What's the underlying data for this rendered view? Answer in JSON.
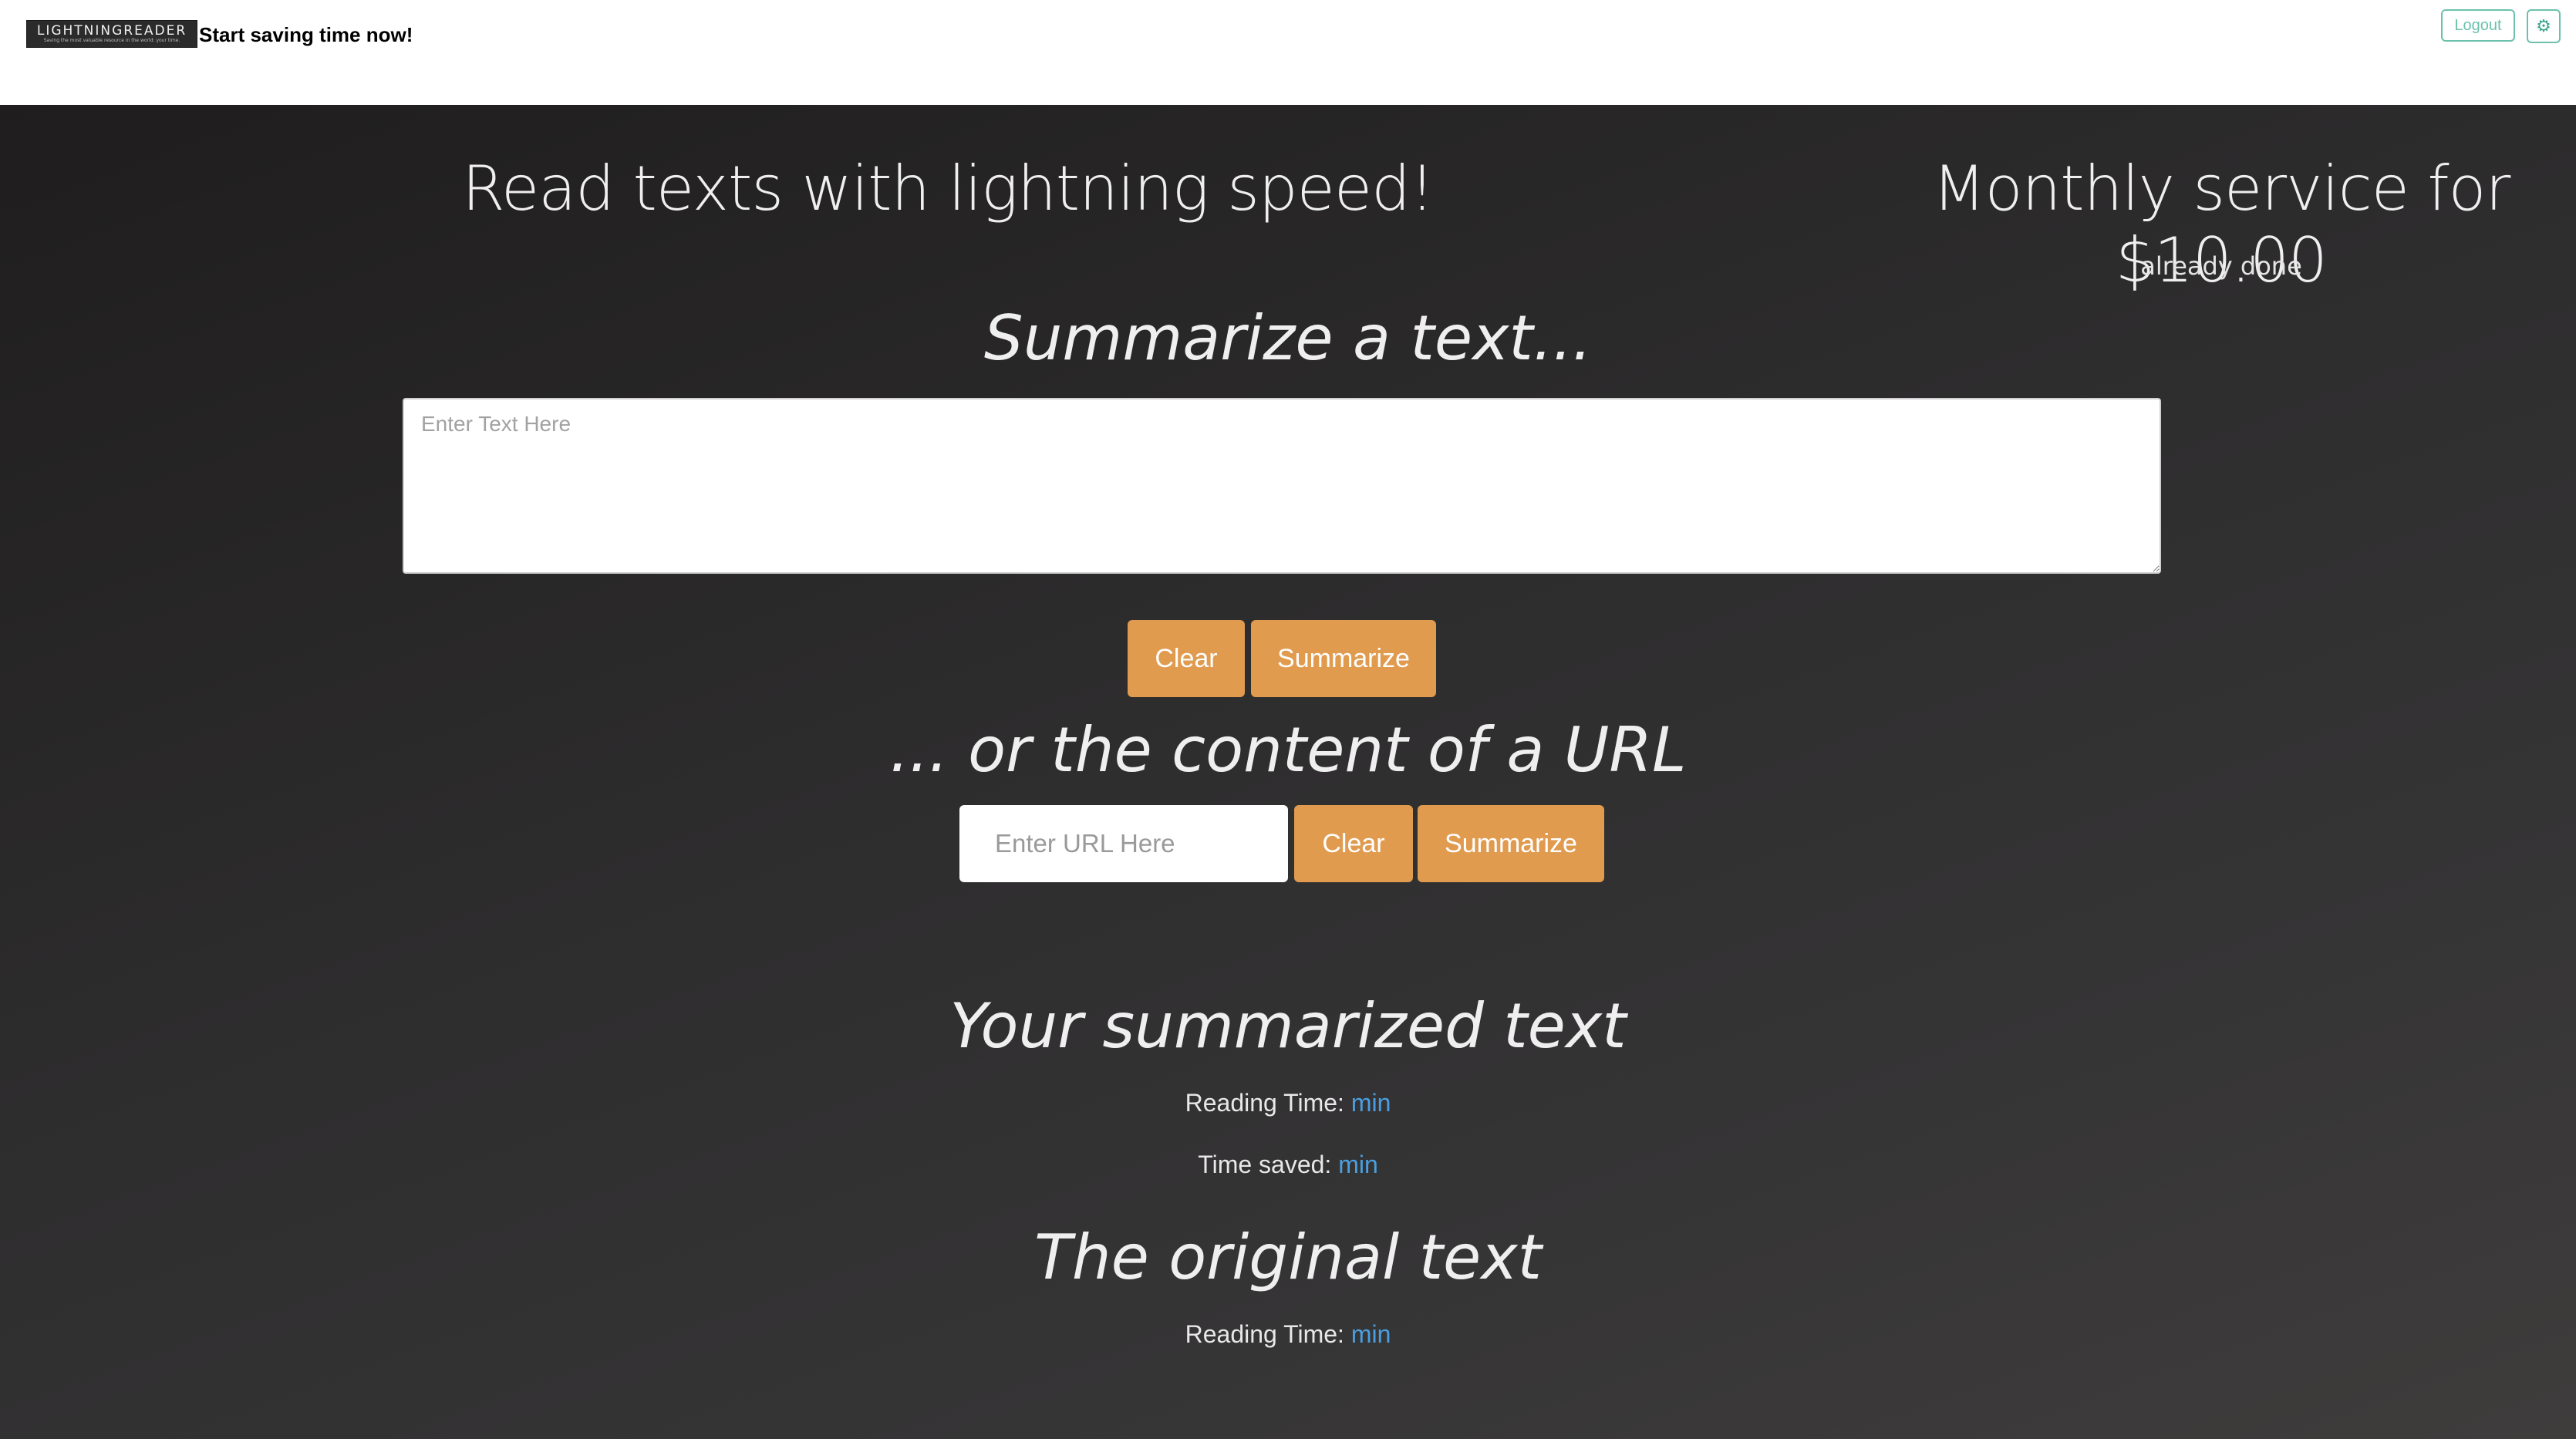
{
  "header": {
    "logo": {
      "word": "LIGHTNINGREADER",
      "tagline": "Saving the most valuable resource in the world: your time."
    },
    "tagline": "Start saving time now!",
    "logout_label": "Logout",
    "settings_icon": "gear-icon"
  },
  "hero": {
    "headline": "Read texts with lightning speed!",
    "price_headline": "Monthly service for $10.00",
    "subscription_status": "already done"
  },
  "text_section": {
    "title": "Summarize a text...",
    "placeholder": "Enter Text Here",
    "clear_label": "Clear",
    "summarize_label": "Summarize"
  },
  "url_section": {
    "title": "... or the content of a URL",
    "placeholder": "Enter URL Here",
    "clear_label": "Clear",
    "summarize_label": "Summarize"
  },
  "summary_section": {
    "title": "Your summarized text",
    "reading_time_label": "Reading Time:",
    "reading_time_unit": "min",
    "time_saved_label": "Time saved:",
    "time_saved_unit": "min"
  },
  "original_section": {
    "title": "The original text",
    "reading_time_label": "Reading Time:",
    "reading_time_unit": "min"
  },
  "colors": {
    "accent": "#e09b4f",
    "teal": "#6cc1ad",
    "link_blue": "#4b9fe0"
  }
}
